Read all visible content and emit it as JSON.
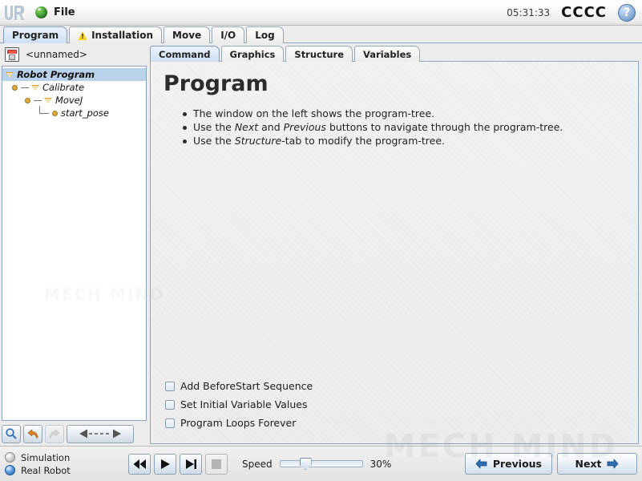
{
  "header": {
    "logo_name": "ur-logo",
    "file_menu_label": "File",
    "file_menu_icon": "globe-icon",
    "clock": "05:31:33",
    "brand": "CCCC",
    "help_icon_label": "?"
  },
  "main_tabs": [
    {
      "label": "Program",
      "active": true,
      "icon": null
    },
    {
      "label": "Installation",
      "active": false,
      "icon": "warning-icon"
    },
    {
      "label": "Move",
      "active": false,
      "icon": null
    },
    {
      "label": "I/O",
      "active": false,
      "icon": null
    },
    {
      "label": "Log",
      "active": false,
      "icon": null
    }
  ],
  "left_panel": {
    "save_icon": "floppy-disk-icon",
    "program_name": "<unnamed>",
    "tree": [
      {
        "label": "Robot Program",
        "level": 0,
        "selected": true,
        "node": "triangle"
      },
      {
        "label": "Calibrate",
        "level": 1,
        "selected": false,
        "node": "triangle"
      },
      {
        "label": "MoveJ",
        "level": 2,
        "selected": false,
        "node": "triangle"
      },
      {
        "label": "start_pose",
        "level": 3,
        "selected": false,
        "node": "dot"
      }
    ],
    "toolbar": [
      {
        "name": "search-button",
        "icon": "magnifier-icon",
        "enabled": true
      },
      {
        "name": "undo-button",
        "icon": "undo-arrow-icon",
        "enabled": true
      },
      {
        "name": "redo-button",
        "icon": "redo-arrow-icon",
        "enabled": false
      },
      {
        "name": "move-node-button",
        "icon": "left-right-arrows-icon",
        "enabled": true
      }
    ]
  },
  "sub_tabs": [
    {
      "label": "Command",
      "active": true
    },
    {
      "label": "Graphics",
      "active": false
    },
    {
      "label": "Structure",
      "active": false
    },
    {
      "label": "Variables",
      "active": false
    }
  ],
  "content": {
    "title": "Program",
    "bullets": [
      {
        "parts": [
          {
            "text": "The window on the left shows the program-tree.",
            "italic": false
          }
        ]
      },
      {
        "parts": [
          {
            "text": "Use the ",
            "italic": false
          },
          {
            "text": "Next",
            "italic": true
          },
          {
            "text": " and ",
            "italic": false
          },
          {
            "text": "Previous",
            "italic": true
          },
          {
            "text": " buttons to navigate through the program-tree.",
            "italic": false
          }
        ]
      },
      {
        "parts": [
          {
            "text": "Use the ",
            "italic": false
          },
          {
            "text": "Structure",
            "italic": true
          },
          {
            "text": "-tab to modify the program-tree.",
            "italic": false
          }
        ]
      }
    ],
    "checkboxes": [
      {
        "label": "Add BeforeStart Sequence",
        "checked": false
      },
      {
        "label": "Set Initial Variable Values",
        "checked": false
      },
      {
        "label": "Program Loops Forever",
        "checked": false
      }
    ]
  },
  "footer": {
    "modes": [
      {
        "label": "Simulation",
        "selected": false
      },
      {
        "label": "Real Robot",
        "selected": true
      }
    ],
    "transport": [
      {
        "name": "rewind-button",
        "icon": "rewind-icon",
        "enabled": true
      },
      {
        "name": "play-button",
        "icon": "play-icon",
        "enabled": true
      },
      {
        "name": "step-button",
        "icon": "step-forward-icon",
        "enabled": true
      },
      {
        "name": "stop-button",
        "icon": "stop-icon",
        "enabled": false
      }
    ],
    "speed_label": "Speed",
    "speed_value": "30%",
    "speed_percent": 30,
    "previous_label": "Previous",
    "next_label": "Next"
  },
  "watermark": {
    "text": "MECH MIND",
    "text2": "MECH MIND"
  },
  "colors": {
    "accent_blue": "#2b6cb0",
    "tab_active": "#cfe0f2",
    "panel_bg": "#ededed",
    "tree_select": "#b9d2ea",
    "warning_yellow": "#f2d12a",
    "tree_node": "#d8a23c"
  }
}
